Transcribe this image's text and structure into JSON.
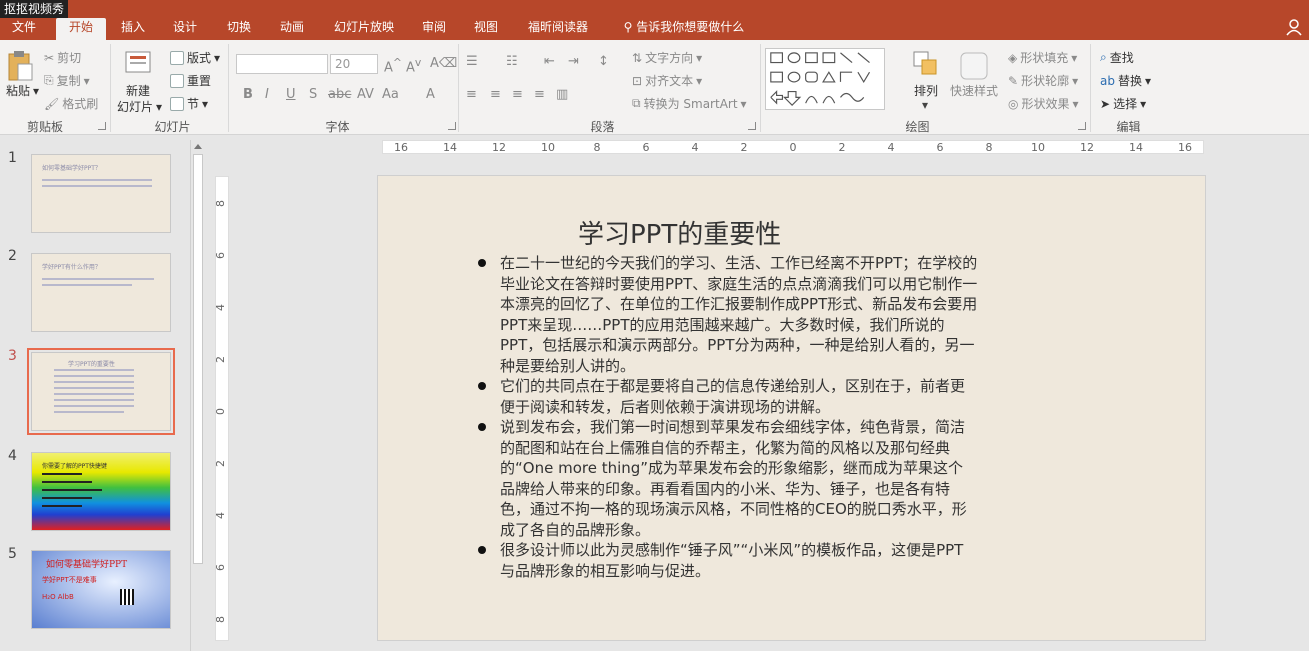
{
  "watermark": "抠抠视频秀",
  "tabs": [
    "文件",
    "开始",
    "插入",
    "设计",
    "切换",
    "动画",
    "幻灯片放映",
    "审阅",
    "视图",
    "福昕阅读器",
    "告诉我你想要做什么"
  ],
  "ribbon": {
    "clipboard": {
      "paste": "粘贴",
      "cut": "剪切",
      "copy": "复制",
      "format_painter": "格式刷",
      "label": "剪贴板"
    },
    "slides": {
      "new_slide": "新建",
      "new_slide2": "幻灯片",
      "layout": "版式",
      "reset": "重置",
      "section": "节",
      "label": "幻灯片"
    },
    "font": {
      "size": "20",
      "label": "字体",
      "aa": "Aa"
    },
    "paragraph": {
      "text_direction": "文字方向",
      "align_text": "对齐文本",
      "smartart": "转换为 SmartArt",
      "label": "段落"
    },
    "drawing": {
      "arrange": "排列",
      "quick_styles": "快速样式",
      "fill": "形状填充",
      "outline": "形状轮廓",
      "effects": "形状效果",
      "label": "绘图"
    },
    "editing": {
      "find": "查找",
      "replace": "替换",
      "select": "选择",
      "label": "编辑"
    }
  },
  "thumbs": [
    {
      "num": "1",
      "title": "如何零基础学好PPT？"
    },
    {
      "num": "2",
      "title": "学好PPT有什么作用？"
    },
    {
      "num": "3",
      "title": "学习PPT的重要性"
    },
    {
      "num": "4",
      "title": "你需要了解的PPT快捷键"
    },
    {
      "num": "5",
      "title": "如何零基础学好PPT",
      "sub1": "学好PPT不是难事",
      "sub2": "H₂O   AlbB"
    }
  ],
  "hruler": [
    "16",
    "14",
    "12",
    "10",
    "8",
    "6",
    "4",
    "2",
    "0",
    "2",
    "4",
    "6",
    "8",
    "10",
    "12",
    "14",
    "16"
  ],
  "vruler": [
    "8",
    "6",
    "4",
    "2",
    "0",
    "2",
    "4",
    "6",
    "8"
  ],
  "slide": {
    "title": "学习PPT的重要性",
    "bullets": [
      "在二十一世纪的今天我们的学习、生活、工作已经离不开PPT；在学校的毕业论文在答辩时要使用PPT、家庭生活的点点滴滴我们可以用它制作一本漂亮的回忆了、在单位的工作汇报要制作成PPT形式、新品发布会要用PPT来呈现……PPT的应用范围越来越广。大多数时候，我们所说的PPT，包括展示和演示两部分。PPT分为两种，一种是给别人看的，另一种是要给别人讲的。",
      "它们的共同点在于都是要将自己的信息传递给别人，区别在于，前者更便于阅读和转发，后者则依赖于演讲现场的讲解。",
      "说到发布会，我们第一时间想到苹果发布会细线字体，纯色背景，简洁的配图和站在台上儒雅自信的乔帮主，化繁为简的风格以及那句经典的“One more thing”成为苹果发布会的形象缩影，继而成为苹果这个品牌给人带来的印象。再看看国内的小米、华为、锤子，也是各有特色，通过不拘一格的现场演示风格，不同性格的CEO的脱口秀水平，形成了各自的品牌形象。",
      "很多设计师以此为灵感制作“锤子风”“小米风”的模板作品，这便是PPT与品牌形象的相互影响与促进。"
    ]
  }
}
